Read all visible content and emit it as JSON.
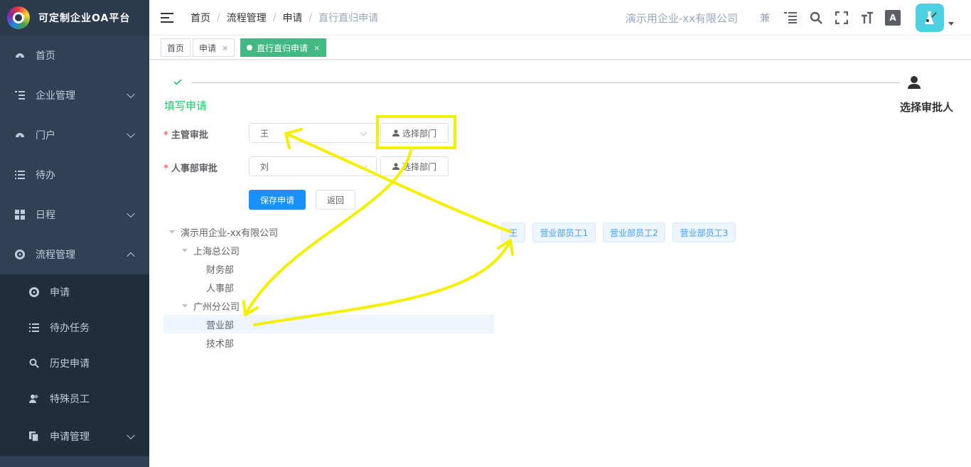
{
  "app": {
    "title": "可定制企业OA平台"
  },
  "sidebar": {
    "items": [
      {
        "label": "首页",
        "icon": "dashboard-icon"
      },
      {
        "label": "企业管理",
        "icon": "list-tree-icon"
      },
      {
        "label": "门户",
        "icon": "dashboard-icon"
      },
      {
        "label": "待办",
        "icon": "list-icon"
      },
      {
        "label": "日程",
        "icon": "grid-icon"
      },
      {
        "label": "流程管理",
        "icon": "gear-icon"
      }
    ],
    "sub_items": [
      {
        "label": "申请",
        "icon": "gear-icon"
      },
      {
        "label": "待办任务",
        "icon": "list-icon"
      },
      {
        "label": "历史申请",
        "icon": "search-icon"
      },
      {
        "label": "特殊员工",
        "icon": "users-icon"
      },
      {
        "label": "申请管理",
        "icon": "copy-icon"
      }
    ]
  },
  "navbar": {
    "breadcrumb": [
      "首页",
      "流程管理",
      "申请",
      "直行直归申请"
    ],
    "company": "演示用企业-xx有限公司",
    "user_short": "兼",
    "font_icon_label": "A"
  },
  "tags": [
    {
      "label": "首页"
    },
    {
      "label": "申请",
      "close": "×"
    },
    {
      "label": "直行直归申请",
      "close": "×"
    }
  ],
  "steps": {
    "step1": "填写申请",
    "step2": "选择审批人"
  },
  "form": {
    "supervisor": {
      "label": "主管审批",
      "value": "王",
      "button": "选择部门"
    },
    "hr": {
      "label": "人事部审批",
      "value": "刘",
      "button": "选择部门"
    },
    "save": "保存申请",
    "back": "返回",
    "required_mark": "*"
  },
  "tree": [
    {
      "label": "演示用企业-xx有限公司"
    },
    {
      "label": "上海总公司"
    },
    {
      "label": "财务部"
    },
    {
      "label": "人事部"
    },
    {
      "label": "广州分公司"
    },
    {
      "label": "营业部"
    },
    {
      "label": "技术部"
    }
  ],
  "employees": [
    "王",
    "营业部员工1",
    "营业部员工2",
    "营业部员工3"
  ],
  "colors": {
    "sidebar_bg": "#304156",
    "submenu_bg": "#1f2d3d",
    "accent_green": "#42b983",
    "primary": "#1890ff",
    "annotation_yellow": "#f5ef00"
  }
}
